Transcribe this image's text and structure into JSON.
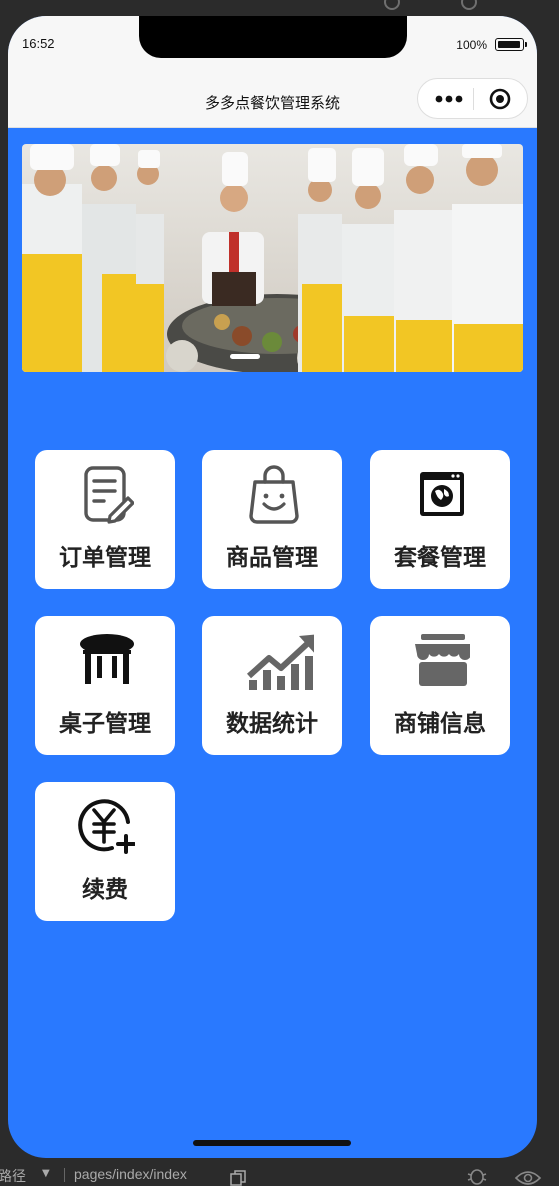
{
  "status_bar": {
    "time": "16:52",
    "battery_percent": "100%"
  },
  "nav": {
    "title": "多多点餐饮管理系统"
  },
  "banner": {
    "active_slide": 1,
    "slide_count": 1
  },
  "menu": {
    "items": [
      {
        "label": "订单管理",
        "icon": "order-document-icon"
      },
      {
        "label": "商品管理",
        "icon": "shopping-bag-icon"
      },
      {
        "label": "套餐管理",
        "icon": "package-window-icon"
      },
      {
        "label": "桌子管理",
        "icon": "table-icon"
      },
      {
        "label": "数据统计",
        "icon": "trend-chart-icon"
      },
      {
        "label": "商铺信息",
        "icon": "storefront-icon"
      },
      {
        "label": "续费",
        "icon": "renew-yuan-icon"
      }
    ]
  },
  "devtools": {
    "path_label": "路径",
    "route": "pages/index/index"
  },
  "colors": {
    "page_background": "#2979ff",
    "card_background": "#ffffff",
    "navbar_background": "#f7f7f7"
  }
}
